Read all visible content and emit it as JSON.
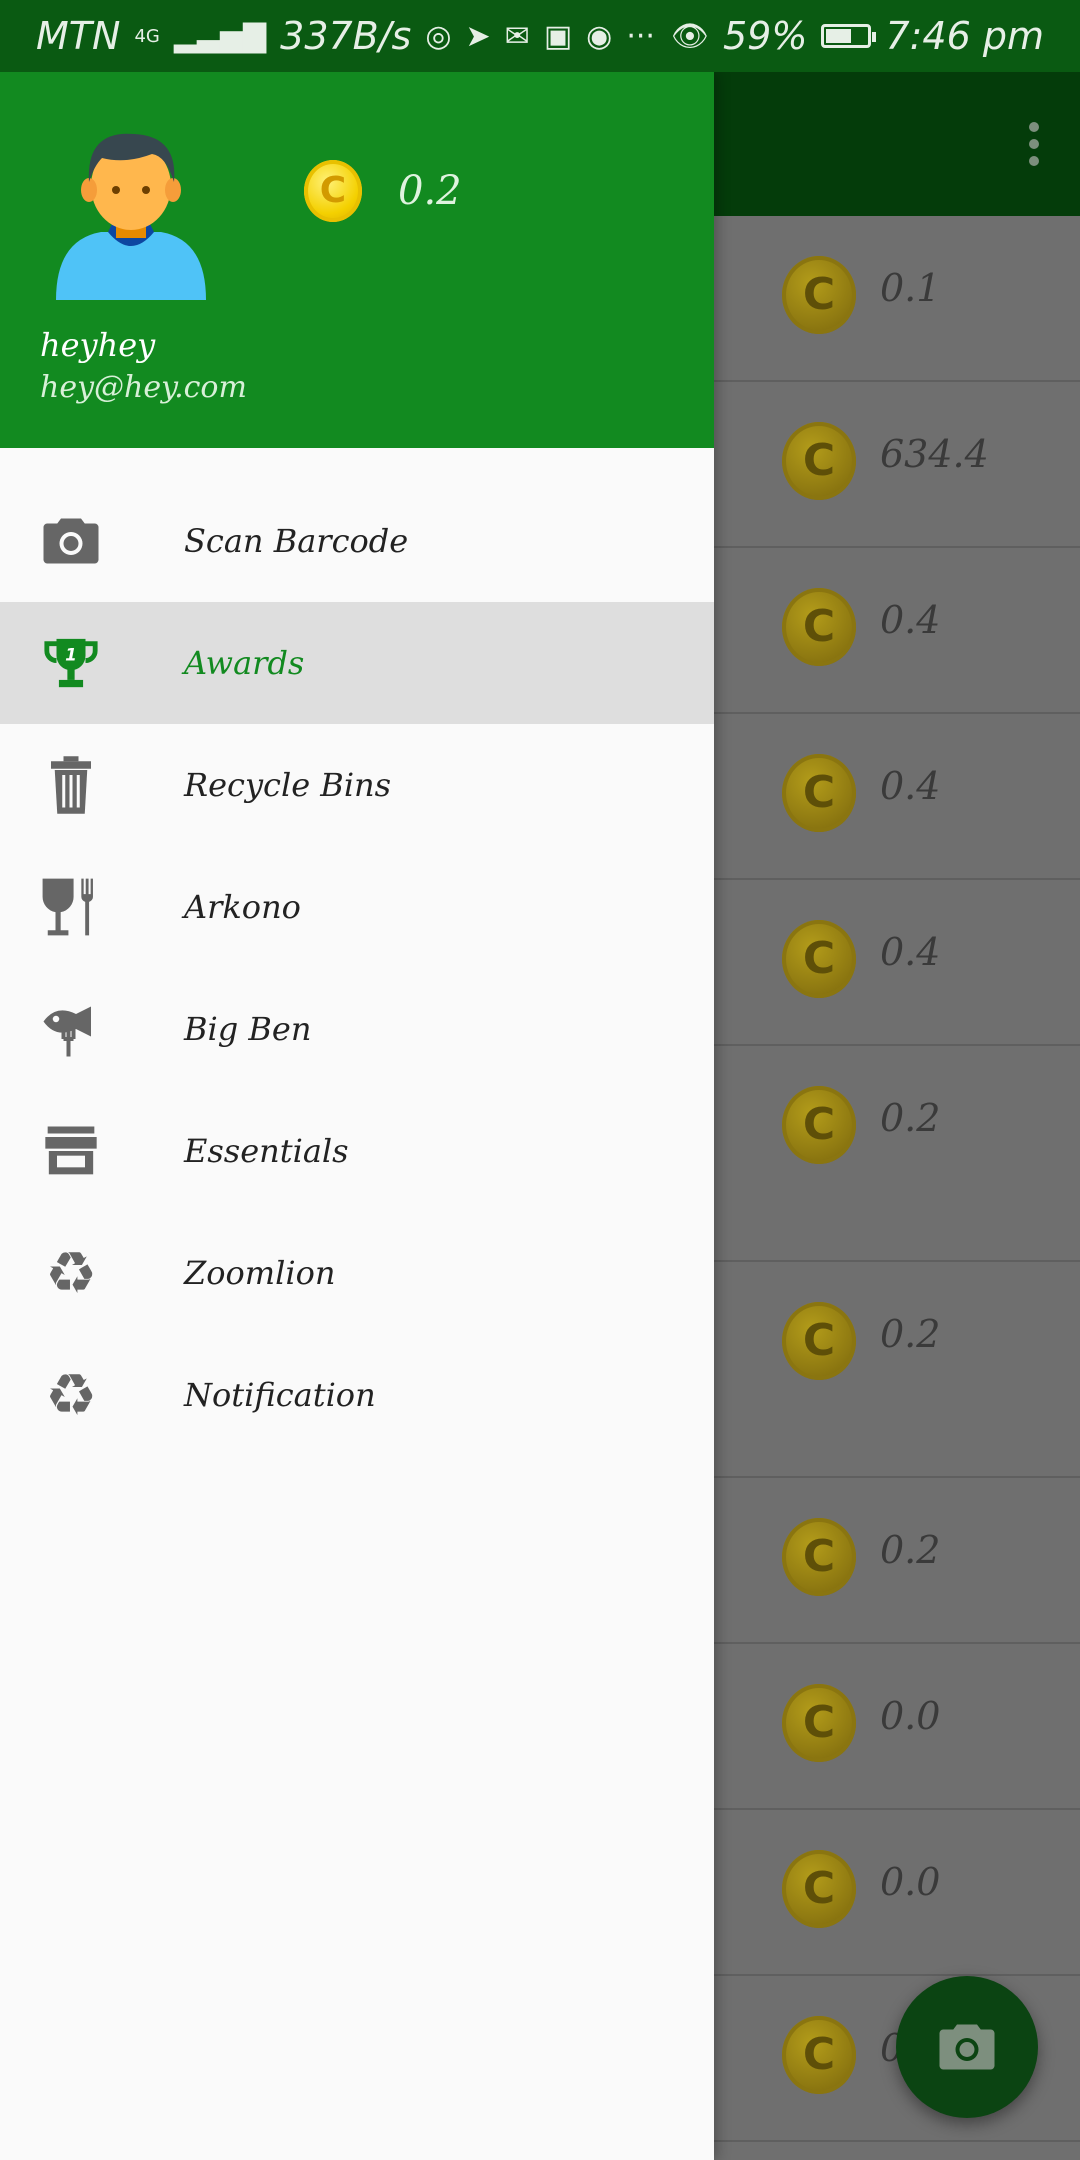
{
  "status_bar": {
    "carrier": "MTN",
    "network": "4G",
    "speed": "337B/s",
    "battery": "59%",
    "time": "7:46 pm"
  },
  "background_list": {
    "values": [
      "0.1",
      "634.4",
      "0.4",
      "0.4",
      "0.4",
      "0.2",
      "0.2",
      "0.2",
      "0.0",
      "0.0",
      "0"
    ]
  },
  "drawer": {
    "header": {
      "balance": "0.2",
      "user_name": "heyhey",
      "user_email": "hey@hey.com"
    },
    "items": [
      {
        "label": "Scan Barcode",
        "icon": "camera-icon"
      },
      {
        "label": "Awards",
        "icon": "trophy-icon",
        "active": true
      },
      {
        "label": "Recycle Bins",
        "icon": "trash-can-icon"
      },
      {
        "label": "Arkono",
        "icon": "glass-fork-icon"
      },
      {
        "label": "Big Ben",
        "icon": "fish-icon"
      },
      {
        "label": "Essentials",
        "icon": "store-icon"
      },
      {
        "label": "Zoomlion",
        "icon": "recycle-icon"
      },
      {
        "label": "Notification",
        "icon": "recycle-icon"
      }
    ]
  },
  "colors": {
    "drawer_header": "#128a20",
    "status_bar": "#0a5a12",
    "active_text": "#128a20",
    "coin": "#f4d000"
  }
}
